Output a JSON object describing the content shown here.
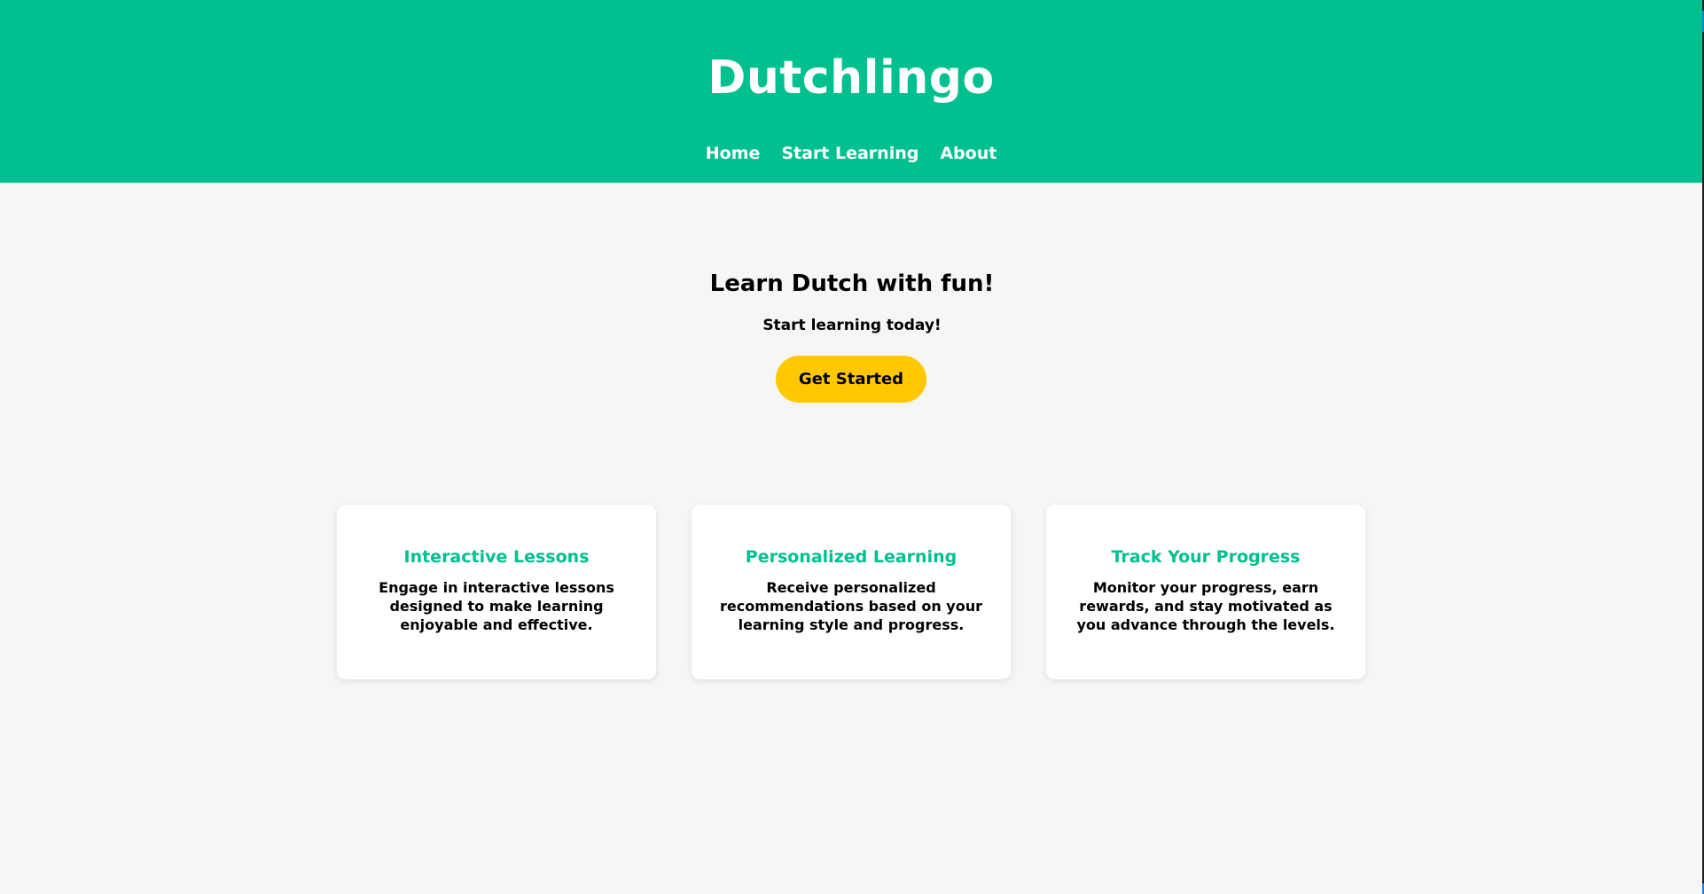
{
  "header": {
    "title": "Dutchlingo",
    "nav": [
      "Home",
      "Start Learning",
      "About"
    ]
  },
  "hero": {
    "title": "Learn Dutch with fun!",
    "subtitle": "Start learning today!",
    "button": "Get Started"
  },
  "features": [
    {
      "title": "Interactive Lessons",
      "text": "Engage in interactive lessons designed to make learning enjoyable and effective."
    },
    {
      "title": "Personalized Learning",
      "text": "Receive personalized recommendations based on your learning style and progress."
    },
    {
      "title": "Track Your Progress",
      "text": "Monitor your progress, earn rewards, and stay motivated as you advance through the levels."
    }
  ],
  "colors": {
    "brand": "#00c08f",
    "accent": "#ffc800",
    "background": "#f6f6f6"
  }
}
